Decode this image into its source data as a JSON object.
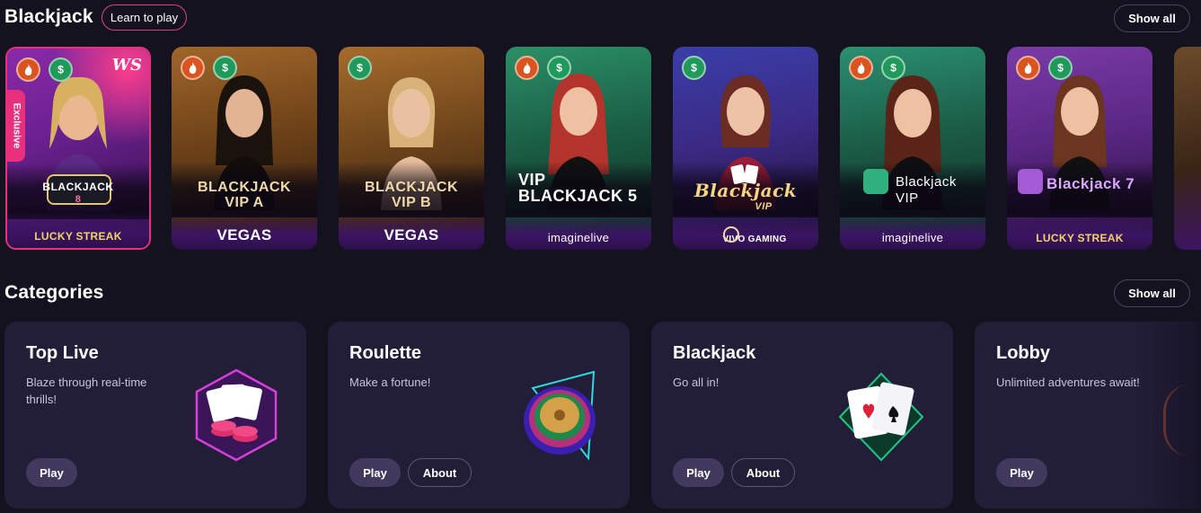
{
  "blackjack_section": {
    "title": "Blackjack",
    "learn_label": "Learn to play",
    "show_all_label": "Show all"
  },
  "games": [
    {
      "title_line1": "BLACKJACK",
      "title_line2": "8",
      "provider": "LUCKY STREAK",
      "badges": [
        "fire-icon",
        "dollar-icon"
      ],
      "exclusive": "Exclusive",
      "corner_logo": "WS"
    },
    {
      "title_line1": "BLACKJACK",
      "title_line2": "VIP A",
      "provider": "VEGAS",
      "badges": [
        "fire-icon",
        "dollar-icon"
      ]
    },
    {
      "title_line1": "BLACKJACK",
      "title_line2": "VIP B",
      "provider": "VEGAS",
      "badges": [
        "dollar-icon"
      ]
    },
    {
      "title_line1": "VIP",
      "title_line2": "BLACKJACK 5",
      "provider": "imaginelive",
      "badges": [
        "fire-icon",
        "dollar-icon"
      ]
    },
    {
      "title_line1": "Blackjack",
      "title_line2": "VIP",
      "provider": "VIVO GAMING",
      "badges": [
        "dollar-icon"
      ]
    },
    {
      "title_line1": "Blackjack",
      "title_line2": "VIP",
      "provider": "imaginelive",
      "badges": [
        "fire-icon",
        "dollar-icon"
      ]
    },
    {
      "title_line1": "Blackjack 7",
      "title_line2": "",
      "provider": "LUCKY STREAK",
      "badges": [
        "fire-icon",
        "dollar-icon"
      ]
    }
  ],
  "categories_section": {
    "title": "Categories",
    "show_all_label": "Show all"
  },
  "categories": [
    {
      "title": "Top Live",
      "description": "Blaze through real-time thrills!",
      "play_label": "Play"
    },
    {
      "title": "Roulette",
      "description": "Make a fortune!",
      "play_label": "Play",
      "about_label": "About"
    },
    {
      "title": "Blackjack",
      "description": "Go all in!",
      "play_label": "Play",
      "about_label": "About"
    },
    {
      "title": "Lobby",
      "description": "Unlimited adventures await!",
      "play_label": "Play"
    }
  ],
  "colors": {
    "page_bg": "#14121f",
    "card_bg": "#231e38",
    "accent_pink": "#e8307e",
    "fire": "#d9541e",
    "cash": "#1f9a5a"
  }
}
